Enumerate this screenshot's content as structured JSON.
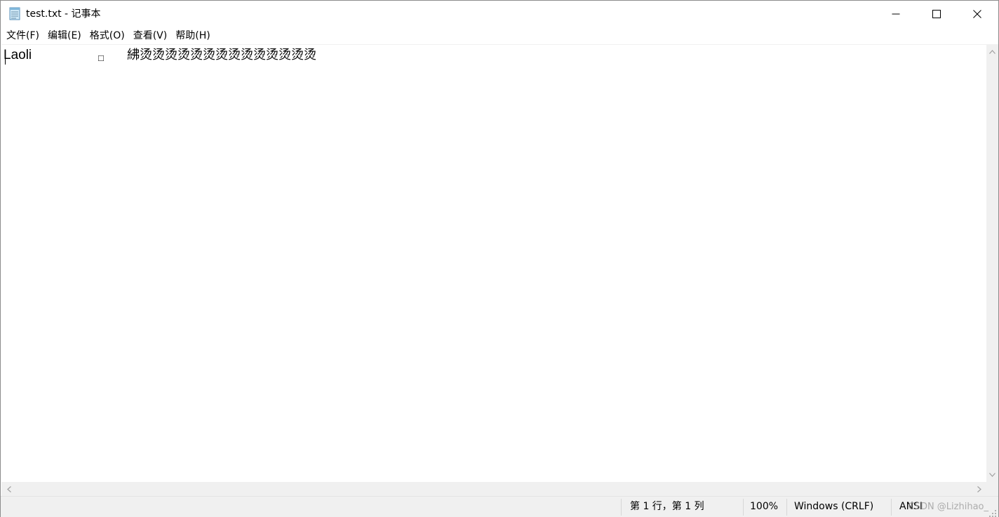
{
  "window": {
    "title": "test.txt - 记事本",
    "icon": "notepad-icon",
    "controls": {
      "minimize_icon": "minimize-icon",
      "maximize_icon": "maximize-icon",
      "close_icon": "close-icon"
    }
  },
  "menu": {
    "items": [
      {
        "label": "文件(F)"
      },
      {
        "label": "编辑(E)"
      },
      {
        "label": "格式(O)"
      },
      {
        "label": "查看(V)"
      },
      {
        "label": "帮助(H)"
      }
    ]
  },
  "editor": {
    "line1": {
      "part1": "Laoli",
      "part2": "□",
      "part3": "紼烫烫烫烫烫烫烫烫烫烫烫烫烫烫"
    }
  },
  "statusbar": {
    "position": "第 1 行，第 1 列",
    "zoom": "100%",
    "line_ending": "Windows (CRLF)",
    "encoding": "ANSI"
  },
  "watermark": "CSDN @Lizhihao_",
  "colors": {
    "chrome": "#f0f0f0",
    "text": "#000000",
    "border": "#8c8c8c"
  }
}
